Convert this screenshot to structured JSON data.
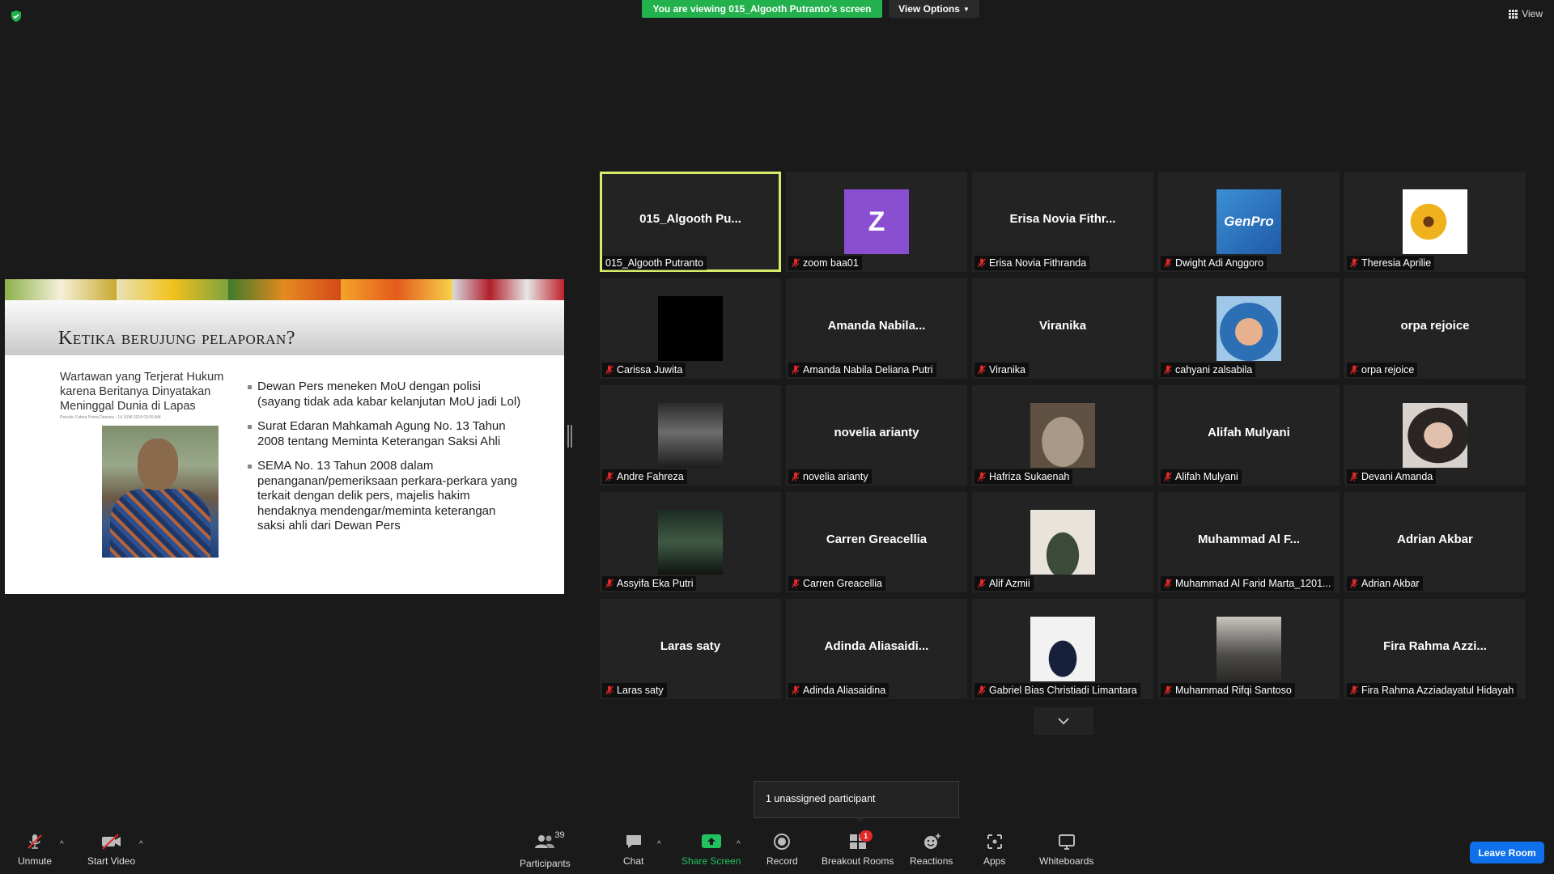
{
  "top": {
    "banner_text": "You are viewing 015_Algooth Putranto's screen",
    "view_options_label": "View Options",
    "view_label": "View"
  },
  "slide": {
    "title": "Ketika berujung pelaporan?",
    "left_caption": "Wartawan yang Terjerat Hukum karena Beritanya Dinyatakan Meninggal Dunia di Lapas",
    "meta": "Penulis: Fatma Prima Damara - 14 JUNI 2018 03:09 AM",
    "bullets": [
      "Dewan Pers meneken MoU dengan polisi (sayang tidak ada kabar kelanjutan MoU jadi Lol)",
      "Surat Edaran Mahkamah Agung No. 13 Tahun 2008 tentang Meminta Keterangan Saksi Ahli",
      "SEMA No. 13 Tahun 2008 dalam penanganan/pemeriksaan perkara-perkara yang terkait dengan delik pers, majelis hakim hendaknya mendengar/meminta keterangan saksi ahli dari Dewan Pers"
    ]
  },
  "gallery": {
    "tiles": [
      {
        "display": "015_Algooth  Pu...",
        "name": "015_Algooth Putranto",
        "muted": false,
        "active": true,
        "avatar": "none"
      },
      {
        "display": "Z",
        "name": "zoom baa01",
        "muted": true,
        "avatar": "letter"
      },
      {
        "display": "Erisa  Novia  Fithr...",
        "name": "Erisa Novia Fithranda",
        "muted": true,
        "avatar": "none"
      },
      {
        "display": "GenPro",
        "name": "Dwight Adi Anggoro",
        "muted": true,
        "avatar": "logo"
      },
      {
        "display": "",
        "name": "Theresia Aprilie",
        "muted": true,
        "avatar": "sunflower-image"
      },
      {
        "display": "",
        "name": "Carissa Juwita",
        "muted": true,
        "avatar": "black-image"
      },
      {
        "display": "Amanda  Nabila...",
        "name": "Amanda Nabila Deliana Putri",
        "muted": true,
        "avatar": "none"
      },
      {
        "display": "Viranika",
        "name": "Viranika",
        "muted": true,
        "avatar": "none"
      },
      {
        "display": "",
        "name": "cahyani zalsabila",
        "muted": true,
        "avatar": "child-photo"
      },
      {
        "display": "orpa rejoice",
        "name": "orpa rejoice",
        "muted": true,
        "avatar": "none"
      },
      {
        "display": "",
        "name": "Andre Fahreza",
        "muted": true,
        "avatar": "street-photo"
      },
      {
        "display": "novelia arianty",
        "name": "novelia arianty",
        "muted": true,
        "avatar": "none"
      },
      {
        "display": "",
        "name": "Hafriza Sukaenah",
        "muted": true,
        "avatar": "cat-photo"
      },
      {
        "display": "Alifah Mulyani",
        "name": "Alifah Mulyani",
        "muted": true,
        "avatar": "none"
      },
      {
        "display": "",
        "name": "Devani Amanda",
        "muted": true,
        "avatar": "portrait-photo"
      },
      {
        "display": "",
        "name": "Assyifa Eka Putri",
        "muted": true,
        "avatar": "city-night-photo"
      },
      {
        "display": "Carren Greacellia",
        "name": "Carren Greacellia",
        "muted": true,
        "avatar": "none"
      },
      {
        "display": "",
        "name": "Alif Azmii",
        "muted": true,
        "avatar": "person-photo"
      },
      {
        "display": "Muhammad  Al  F...",
        "name": "Muhammad Al Farid Marta_1201...",
        "muted": true,
        "avatar": "none"
      },
      {
        "display": "Adrian Akbar",
        "name": "Adrian Akbar",
        "muted": true,
        "avatar": "none"
      },
      {
        "display": "Laras saty",
        "name": "Laras saty",
        "muted": true,
        "avatar": "none"
      },
      {
        "display": "Adinda  Aliasaidi...",
        "name": "Adinda Aliasaidina",
        "muted": true,
        "avatar": "none"
      },
      {
        "display": "",
        "name": "Gabriel Bias Christiadi Limantara",
        "muted": true,
        "avatar": "suit-photo"
      },
      {
        "display": "",
        "name": "Muhammad Rifqi Santoso",
        "muted": true,
        "avatar": "group-photo"
      },
      {
        "display": "Fira  Rahma  Azzi...",
        "name": "Fira Rahma Azziadayatul Hidayah",
        "muted": true,
        "avatar": "none"
      }
    ]
  },
  "tooltip": {
    "text": "1 unassigned participant"
  },
  "toolbar": {
    "unmute": "Unmute",
    "start_video": "Start Video",
    "participants": "Participants",
    "participants_count": "39",
    "chat": "Chat",
    "share_screen": "Share Screen",
    "record": "Record",
    "breakout_rooms": "Breakout Rooms",
    "breakout_badge": "1",
    "reactions": "Reactions",
    "apps": "Apps",
    "whiteboards": "Whiteboards",
    "leave_room": "Leave Room"
  },
  "colors": {
    "accent_green": "#22b14c",
    "active_outline": "#d9ea6b",
    "leave_blue": "#0e71eb",
    "mute_red": "#e02828"
  }
}
